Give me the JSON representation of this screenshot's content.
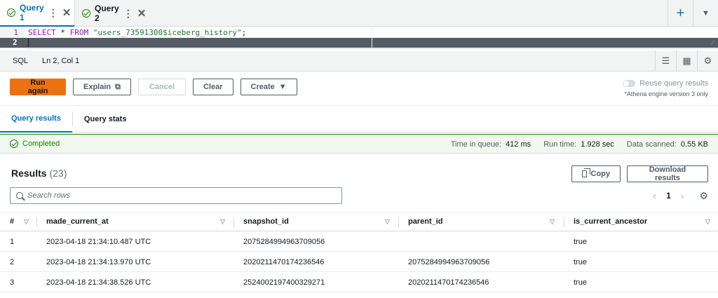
{
  "tabs": [
    {
      "label": "Query 1"
    },
    {
      "label": "Query 2"
    }
  ],
  "editor": {
    "lines": [
      "1",
      "2"
    ],
    "keyword_select": "SELECT",
    "star": " * ",
    "keyword_from": "FROM",
    "string": "\"users_73591300$iceberg_history\"",
    "semicolon": ";"
  },
  "status": {
    "language": "SQL",
    "position": "Ln 2, Col 1"
  },
  "actions": {
    "run_again": "Run again",
    "explain": "Explain",
    "cancel": "Cancel",
    "clear": "Clear",
    "create": "Create"
  },
  "reuse": {
    "label": "Reuse query results",
    "note": "*Athena engine version 3 only"
  },
  "result_tabs": [
    {
      "label": "Query results"
    },
    {
      "label": "Query stats"
    }
  ],
  "completed": {
    "label": "Completed",
    "time_in_queue_label": "Time in queue:",
    "time_in_queue": "412 ms",
    "run_time_label": "Run time:",
    "run_time": "1.928 sec",
    "data_scanned_label": "Data scanned:",
    "data_scanned": "0.55 KB"
  },
  "results": {
    "title": "Results",
    "count": "(23)",
    "copy": "Copy",
    "download": "Download results",
    "search_placeholder": "Search rows",
    "page": "1"
  },
  "table": {
    "headers": [
      "#",
      "made_current_at",
      "snapshot_id",
      "parent_id",
      "is_current_ancestor"
    ],
    "rows": [
      [
        "1",
        "2023-04-18 21:34:10.487 UTC",
        "2075284994963709056",
        "",
        "true"
      ],
      [
        "2",
        "2023-04-18 21:34:13.970 UTC",
        "2020211470174236546",
        "2075284994963709056",
        "true"
      ],
      [
        "3",
        "2023-04-18 21:34:38.526 UTC",
        "2524002197400329271",
        "2020211470174236546",
        "true"
      ]
    ]
  },
  "colors": {
    "accent": "#0073bb",
    "primary_button": "#ec7211",
    "success": "#1d8102"
  }
}
